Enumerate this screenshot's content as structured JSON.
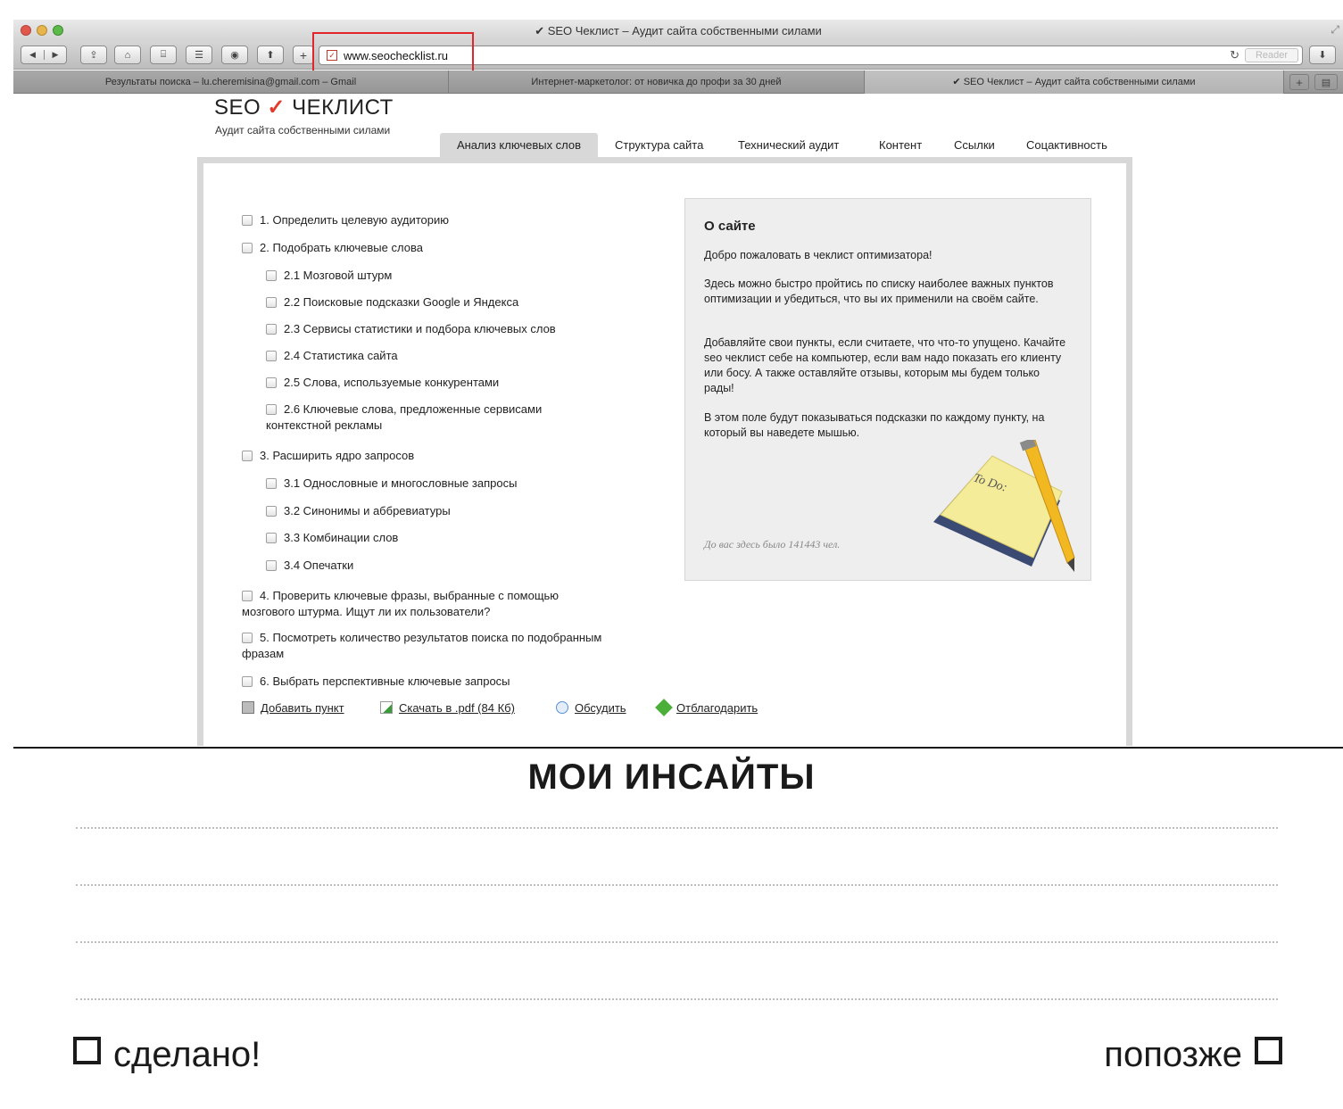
{
  "browser": {
    "window_title": "✔ SEO Чеклист – Аудит сайта собственными силами",
    "url": "www.seochecklist.ru",
    "reader_label": "Reader",
    "tabs": [
      {
        "label": "Результаты поиска – lu.cheremisina@gmail.com – Gmail"
      },
      {
        "label": "Интернет-маркетолог: от новичка до профи за 30 дней"
      },
      {
        "label": "✔ SEO Чеклист – Аудит сайта собственными силами"
      }
    ],
    "new_tab_label": "+",
    "highlight_color": "#e0262b"
  },
  "site": {
    "logo_seo": "SEO",
    "logo_check": "✓",
    "logo_word": "ЧЕКЛИСТ",
    "tagline": "Аудит сайта собственными силами",
    "nav_tabs": [
      {
        "label": "Анализ ключевых слов",
        "active": true
      },
      {
        "label": "Структура сайта"
      },
      {
        "label": "Технический аудит"
      },
      {
        "label": "Контент"
      },
      {
        "label": "Ссылки"
      },
      {
        "label": "Соцактивность"
      }
    ],
    "checklist": [
      {
        "label": "1. Определить целевую аудиторию"
      },
      {
        "label": "2. Подобрать ключевые слова"
      },
      {
        "label": "2.1 Мозговой штурм"
      },
      {
        "label": "2.2 Поисковые подсказки Google и Яндекса"
      },
      {
        "label": "2.3 Сервисы статистики и подбора ключевых слов"
      },
      {
        "label": "2.4 Статистика сайта"
      },
      {
        "label": "2.5 Слова, используемые конкурентами"
      },
      {
        "label": "2.6 Ключевые слова, предложенные сервисами",
        "label_cont": "контекстной рекламы"
      },
      {
        "label": "3. Расширить ядро запросов"
      },
      {
        "label": "3.1 Однословные и многословные запросы"
      },
      {
        "label": "3.2 Синонимы и аббревиатуры"
      },
      {
        "label": "3.3 Комбинации слов"
      },
      {
        "label": "3.4 Опечатки"
      },
      {
        "label": "4. Проверить ключевые фразы, выбранные с помощью",
        "label_cont": "мозгового штурма. Ищут ли их пользователи?"
      },
      {
        "label": "5. Посмотреть количество результатов поиска по подобранным",
        "label_cont": "фразам"
      },
      {
        "label": "6. Выбрать перспективные ключевые запросы"
      }
    ],
    "about": {
      "title": "О сайте",
      "p1": "Добро пожаловать в чеклист оптимизатора!",
      "p2": "Здесь можно быстро пройтись по списку наиболее важных пунктов оптимизации и убедиться, что вы их применили на своём сайте.",
      "p3": "Добавляйте свои пункты, если считаете, что что-то упущено. Качайте seo чеклист себе на компьютер, если вам надо показать его клиенту или босу. А также оставляйте отзывы, которым мы будем только рады!",
      "p4": "В этом поле будут показываться подсказки по каждому пункту, на который вы наведете мышью.",
      "counter": "До вас здесь было 141443 чел.",
      "note_text": "To Do:"
    },
    "actions": {
      "add": "Добавить пункт",
      "download": "Скачать в .pdf (84 Кб)",
      "discuss": "Обсудить",
      "thank": "Отблагодарить"
    },
    "accent_color": "#e33a2c"
  },
  "worksheet": {
    "title": "МОИ ИНСАЙТЫ",
    "done_label": "сделано!",
    "later_label": "попозже"
  }
}
